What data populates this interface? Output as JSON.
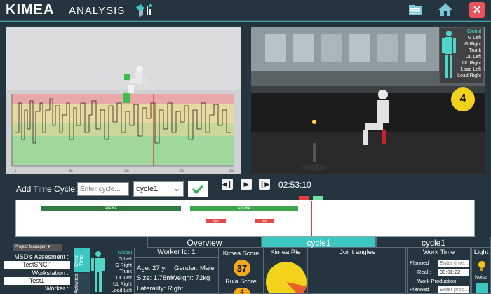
{
  "header": {
    "logo": "KIMEA",
    "subtitle": "ANALYSIS",
    "folder_icon": "folder-icon",
    "home_icon": "home-icon",
    "close_label": "✕"
  },
  "legend": {
    "items": [
      "Global",
      "G Left",
      "G Right",
      "Trunk",
      "UL Left",
      "UL Right",
      "Load Left",
      "Load Right"
    ],
    "active": "Global",
    "count": "4"
  },
  "controls": {
    "add_time_cycle_label": "Add Time Cycle:",
    "cycle_input_placeholder": "Enter cycle...",
    "cycle_select_value": "cycle1",
    "time": "02:53:10"
  },
  "timeline": {
    "segments": [
      {
        "label": "cycle1",
        "color": "#2f7a3f"
      },
      {
        "label": "cycle1",
        "color": "#3ea64f"
      }
    ],
    "events": [
      "trpr",
      "trpr"
    ]
  },
  "tabs": [
    "Overview",
    "cycle1",
    "cycle1"
  ],
  "project": {
    "manager_label": "Project Manager",
    "fields": [
      {
        "label": "MSD's Assesment :",
        "value": "TestSNCF"
      },
      {
        "label": "Workstation :",
        "value": "Test1"
      },
      {
        "label": "Worker :",
        "value": ""
      }
    ]
  },
  "side_tabs": [
    "Cycle Time",
    "Activities"
  ],
  "body_legend": [
    "Global",
    "G Left",
    "G Right",
    "Trunk",
    "UL Left",
    "UL Right",
    "Load Left"
  ],
  "worker": {
    "title": "Worker Id: 1",
    "age": "Age: 27 yr",
    "gender": "Gender: Male",
    "size": "Size: 1.78m",
    "weight": "Weight: 72kg",
    "laterality": "Laterality: Right"
  },
  "scores": {
    "kimea_title": "Kimea Score",
    "kimea_value": "37",
    "rula_title": "Rula Score",
    "rula_value": "4"
  },
  "pie": {
    "title": "Kimea Pie",
    "colors": [
      "#f2d21a",
      "#e8612c"
    ]
  },
  "joint": {
    "title": "Joint angles"
  },
  "work_time": {
    "title": "Work Time",
    "planned_label": "Planned :",
    "planned_placeholder": "Enter time...",
    "real_label": "Real :",
    "real_value": "00:01:22",
    "production_title": "Work Production",
    "prod_planned_label": "Planned :",
    "prod_planned_placeholder": "Enter prod..."
  },
  "light": {
    "title": "Light",
    "noise": "Noise"
  }
}
